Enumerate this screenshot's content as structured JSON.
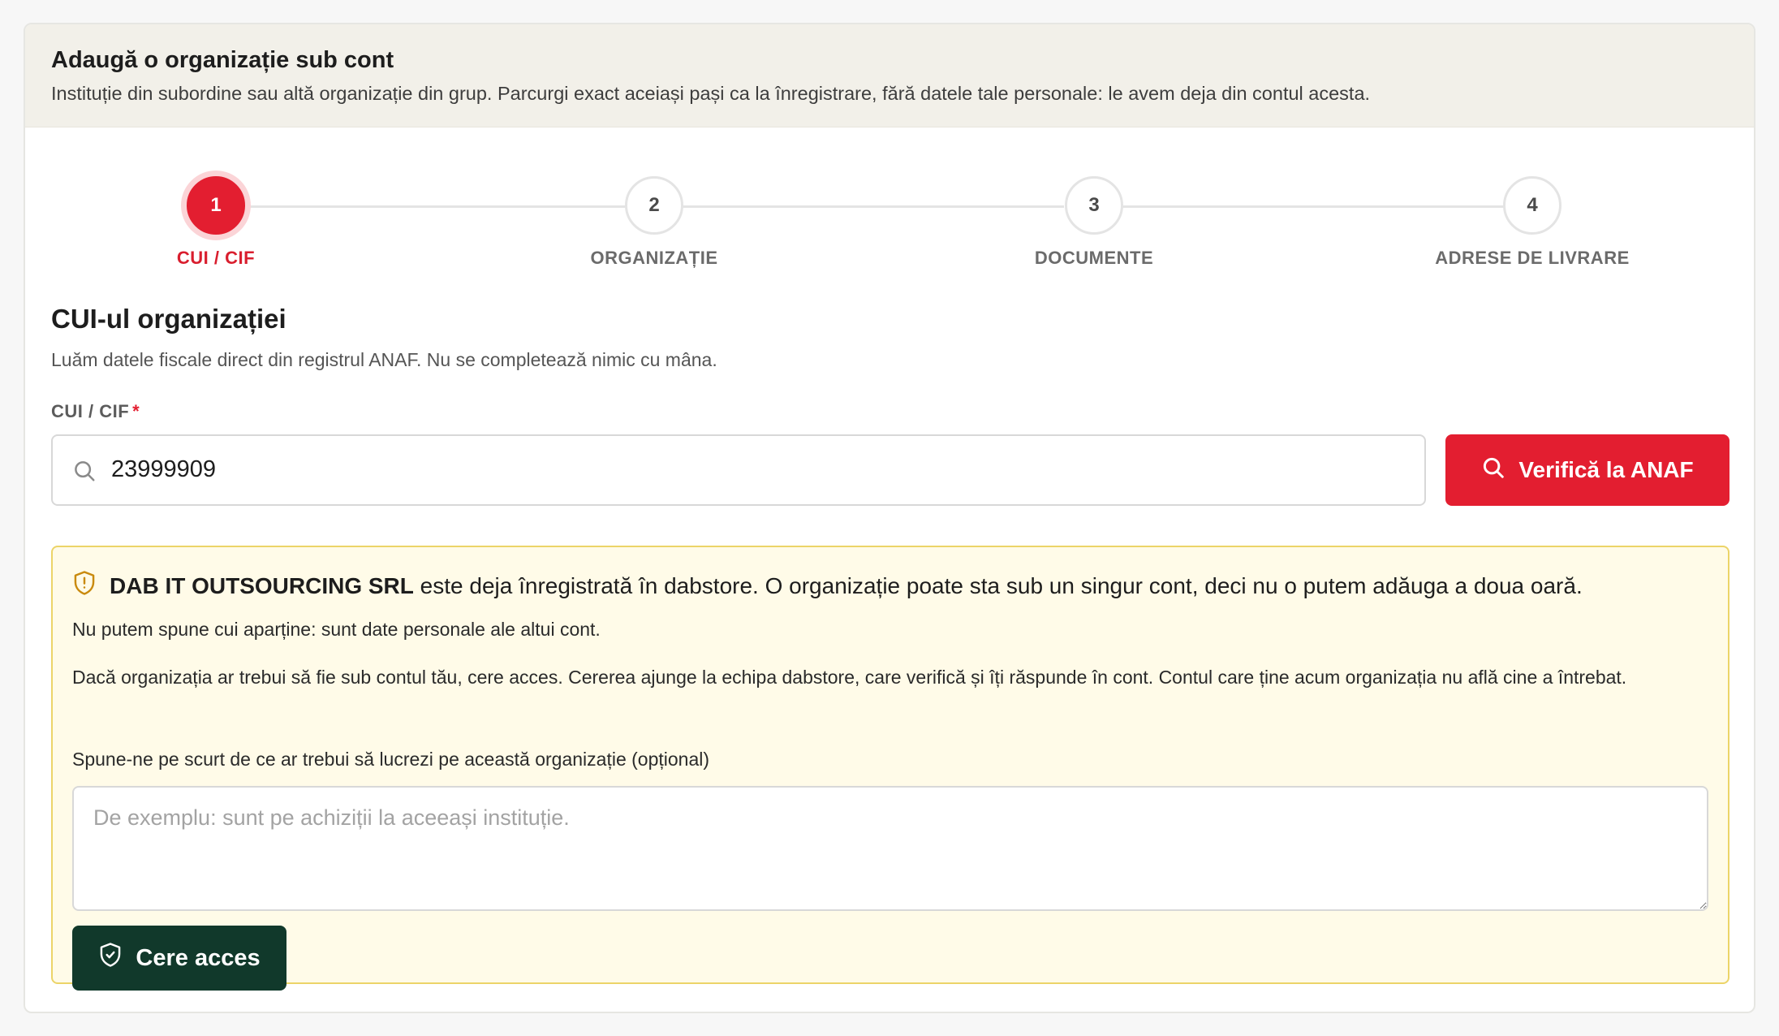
{
  "header": {
    "title": "Adaugă o organizație sub cont",
    "subtitle": "Instituție din subordine sau altă organizație din grup. Parcurgi exact aceiași pași ca la înregistrare, fără datele tale personale: le avem deja din contul acesta."
  },
  "stepper": {
    "steps": [
      {
        "number": "1",
        "label": "CUI / CIF",
        "state": "active"
      },
      {
        "number": "2",
        "label": "ORGANIZAȚIE",
        "state": "pending"
      },
      {
        "number": "3",
        "label": "DOCUMENTE",
        "state": "pending"
      },
      {
        "number": "4",
        "label": "ADRESE DE LIVRARE",
        "state": "pending"
      }
    ]
  },
  "section": {
    "title": "CUI-ul organizației",
    "description": "Luăm datele fiscale direct din registrul ANAF. Nu se completează nimic cu mâna."
  },
  "cui_field": {
    "label": "CUI / CIF",
    "required_mark": "*",
    "value": "23999909",
    "icon": "search-icon"
  },
  "verify_button": {
    "label": "Verifică la ANAF",
    "icon": "search-icon"
  },
  "warning": {
    "icon": "shield-alert-icon",
    "org_name": "DAB IT OUTSOURCING SRL",
    "message": " este deja înregistrată în dabstore. O organizație poate sta sub un singur cont, deci nu o putem adăuga a doua oară.",
    "privacy_note": "Nu putem spune cui aparține: sunt date personale ale altui cont.",
    "explanation": "Dacă organizația ar trebui să fie sub contul tău, cere acces. Cererea ajunge la echipa dabstore, care verifică și îți răspunde în cont. Contul care ține acum organizația nu află cine a întrebat.",
    "reason_label": "Spune-ne pe scurt de ce ar trebui să lucrezi pe această organizație (opțional)",
    "reason_placeholder": "De exemplu: sunt pe achiziții la aceeași instituție.",
    "reason_value": "",
    "request_button": {
      "label": "Cere acces",
      "icon": "shield-check-icon"
    }
  },
  "colors": {
    "accent": "#e31e30",
    "dark_green": "#11392b",
    "warning_bg": "#fffbe8",
    "warning_border": "#ecd468",
    "header_bg": "#f2f0e9"
  }
}
